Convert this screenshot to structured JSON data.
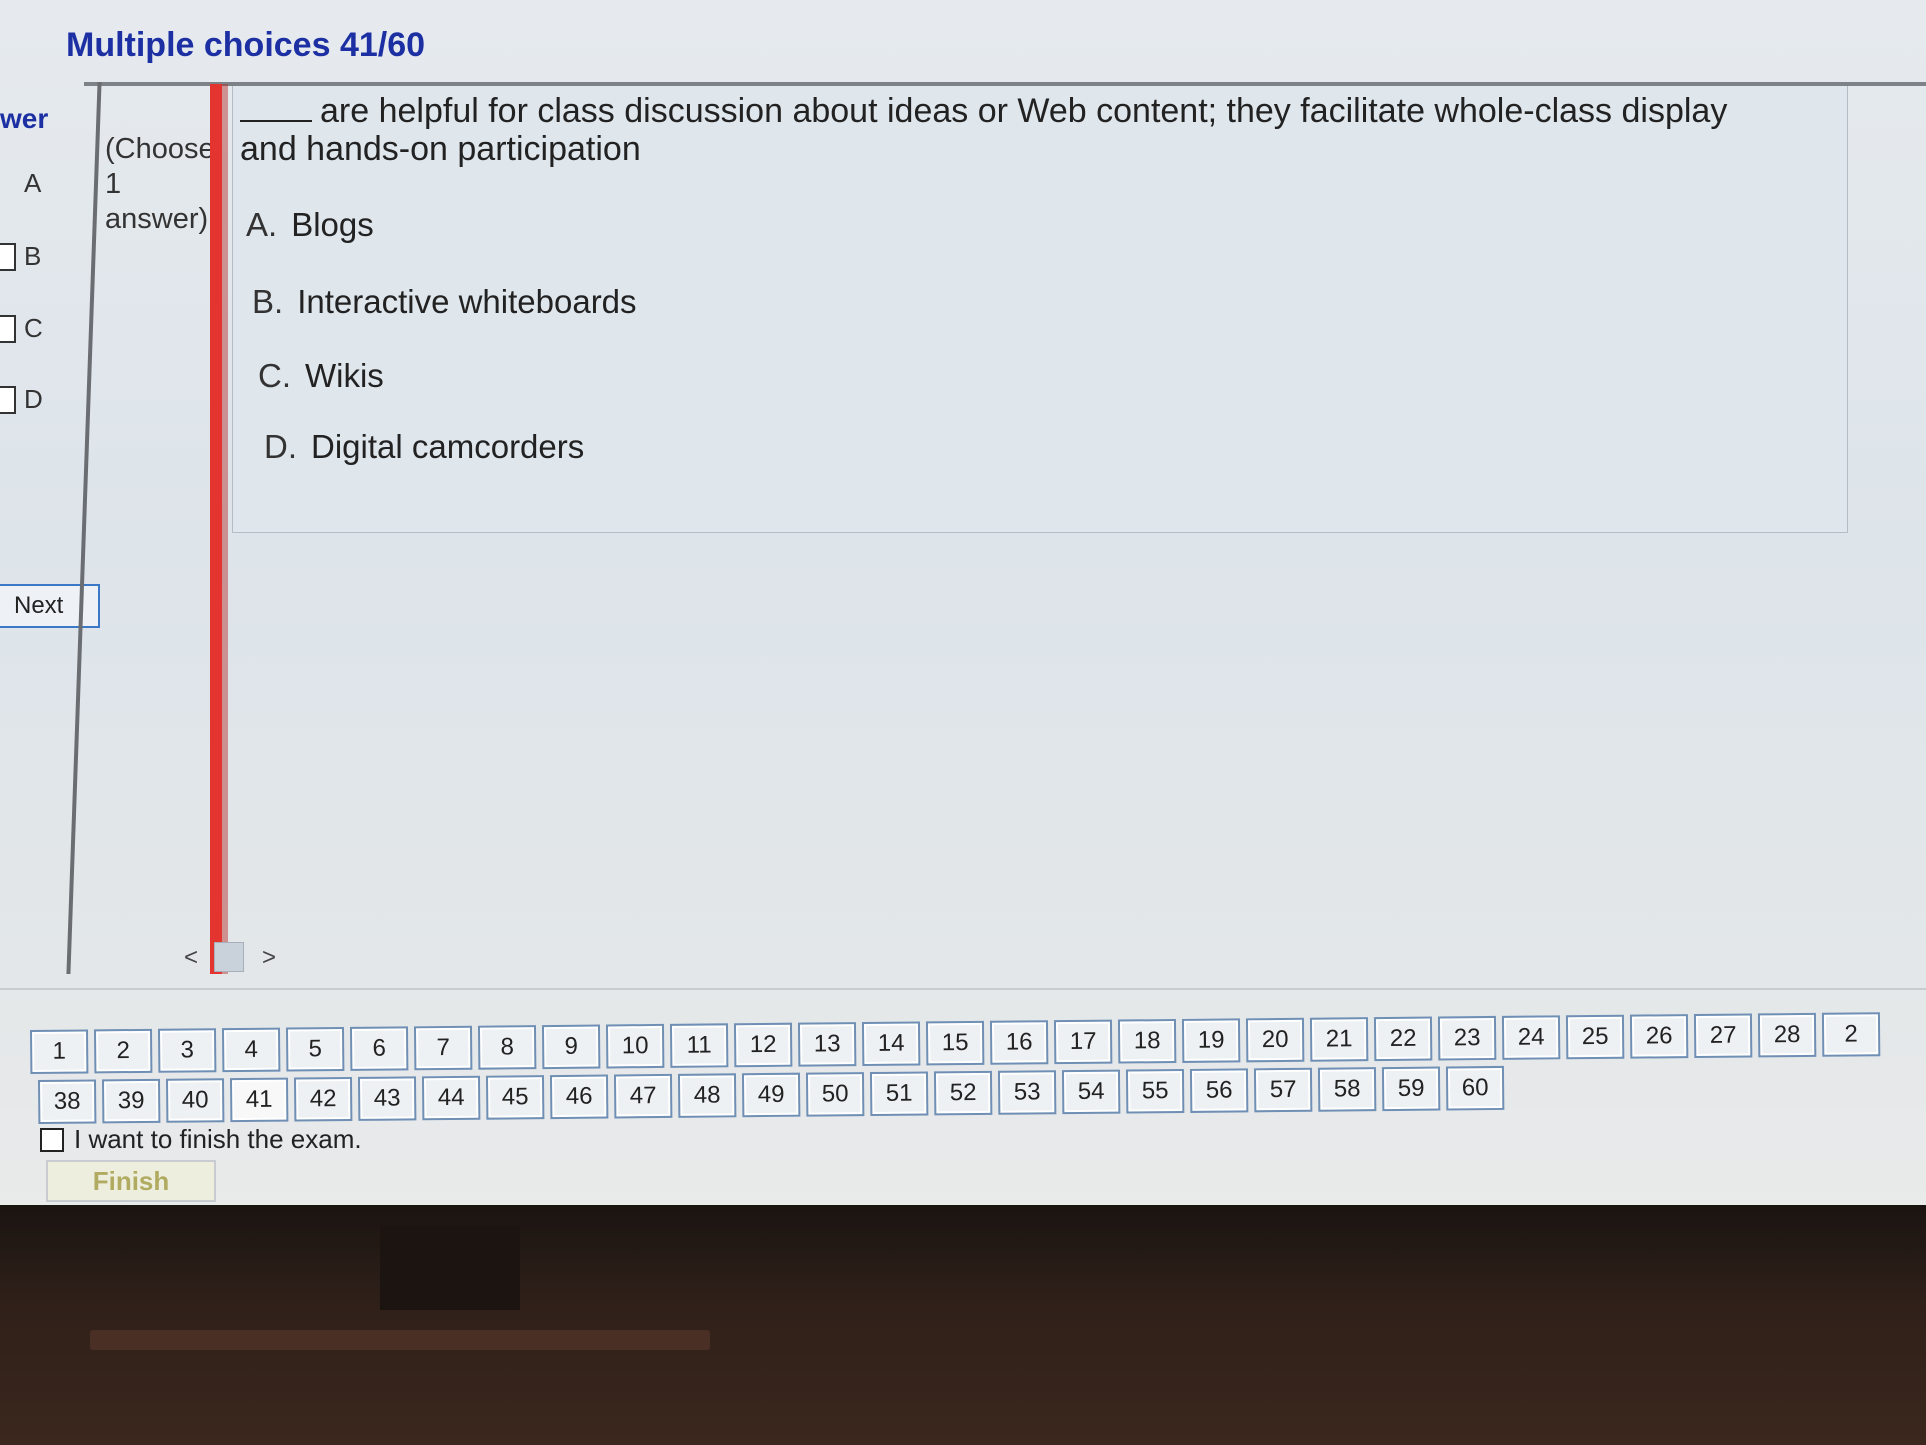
{
  "header": {
    "title": "Multiple choices 41/60"
  },
  "side_panel": {
    "header": "wer",
    "options": [
      "A",
      "B",
      "C",
      "D"
    ],
    "next_label": "Next"
  },
  "question": {
    "instruction_lines": [
      "(Choose",
      "1",
      "answer)"
    ],
    "text": "are helpful for class discussion about ideas or Web content; they facilitate whole-class display and hands-on participation",
    "options": [
      {
        "letter": "A.",
        "text": "Blogs"
      },
      {
        "letter": "B.",
        "text": "Interactive whiteboards"
      },
      {
        "letter": "C.",
        "text": "Wikis"
      },
      {
        "letter": "D.",
        "text": "Digital camcorders"
      }
    ]
  },
  "scroll": {
    "left": "<",
    "right": ">"
  },
  "navigation": {
    "row1": [
      "1",
      "2",
      "3",
      "4",
      "5",
      "6",
      "7",
      "8",
      "9",
      "10",
      "11",
      "12",
      "13",
      "14",
      "15",
      "16",
      "17",
      "18",
      "19",
      "20",
      "21",
      "22",
      "23",
      "24",
      "25",
      "26",
      "27",
      "28",
      "2"
    ],
    "row2": [
      "38",
      "39",
      "40",
      "41",
      "42",
      "43",
      "44",
      "45",
      "46",
      "47",
      "48",
      "49",
      "50",
      "51",
      "52",
      "53",
      "54",
      "55",
      "56",
      "57",
      "58",
      "59",
      "60"
    ],
    "current": "41"
  },
  "finish": {
    "checkbox_label": "I want to finish the exam.",
    "button_label": "Finish"
  }
}
